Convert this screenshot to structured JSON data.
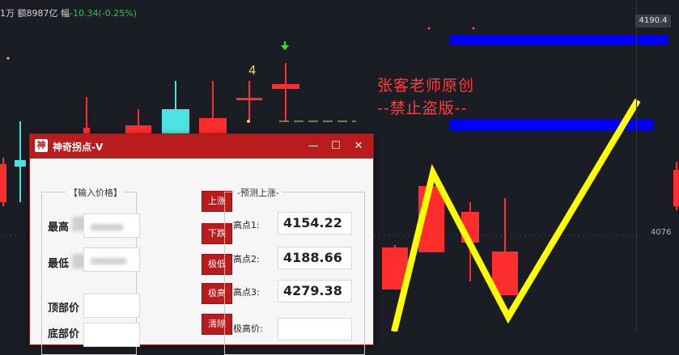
{
  "top_info": {
    "volume": "1万 额8987亿",
    "change_label": "幅",
    "change": "-10.34(-0.25%)"
  },
  "axis": {
    "price_tag": "4190.4",
    "tick": "4076"
  },
  "chart": {
    "marker_label": "4",
    "up_color": "#ff2d2d",
    "down_color": "#4de3e3",
    "zigzag_color": "#ffff00",
    "band_color": "#0000ff"
  },
  "watermark": {
    "line1": "张客老师原创",
    "line2": "--禁止盗版--"
  },
  "dialog": {
    "icon_char": "神",
    "title": "神奇拐点-V",
    "controls": {
      "minimize": "—",
      "maximize": "☐",
      "close": "✕"
    },
    "input_group": {
      "legend": "【输入价格】",
      "high_label": "最高",
      "low_label": "最低",
      "top_label": "顶部价",
      "bottom_label": "底部价"
    },
    "buttons": [
      "上涨",
      "下跌",
      "极低",
      "极高",
      "清除"
    ],
    "predict_group": {
      "legend": "-预测上涨-",
      "points": [
        {
          "label": "高点1:",
          "value": "4154.22"
        },
        {
          "label": "高点2:",
          "value": "4188.66"
        },
        {
          "label": "高点3:",
          "value": "4279.38"
        }
      ],
      "extreme_label": "极高价:"
    }
  }
}
